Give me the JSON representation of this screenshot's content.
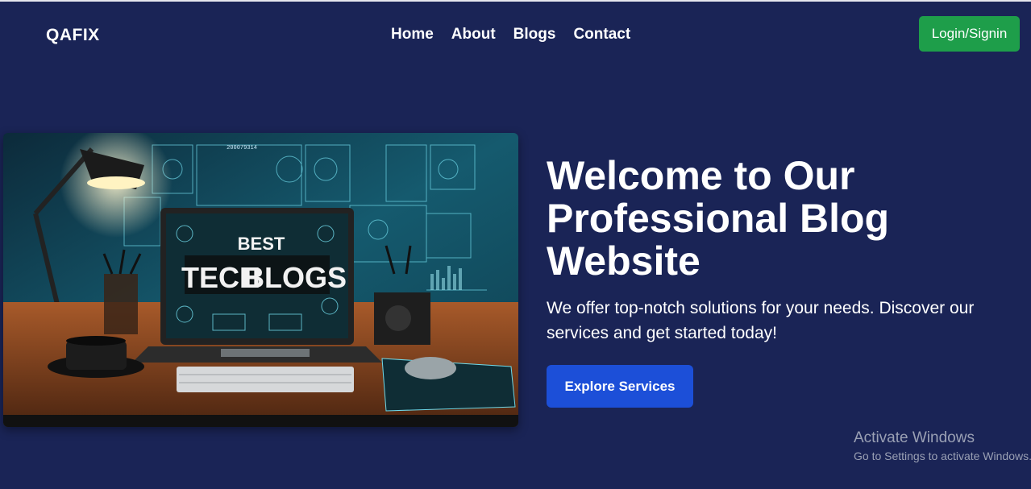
{
  "brand": {
    "name": "QAFIX"
  },
  "nav": {
    "items": [
      "Home",
      "About",
      "Blogs",
      "Contact"
    ]
  },
  "header": {
    "login_label": "Login/Signin"
  },
  "hero": {
    "image_text_top": "BEST",
    "image_text_main_left": "TECH",
    "image_text_main_right": "BLOGS",
    "image_number": "200079314",
    "title": "Welcome to Our Professional Blog Website",
    "description": "We offer top-notch solutions for your needs. Discover our services and get started today!",
    "cta_label": "Explore Services"
  },
  "watermark": {
    "title": "Activate Windows",
    "subtitle": "Go to Settings to activate Windows."
  },
  "colors": {
    "background": "#1a2456",
    "login_button": "#1e9e4a",
    "cta_button": "#1c4fd8"
  }
}
